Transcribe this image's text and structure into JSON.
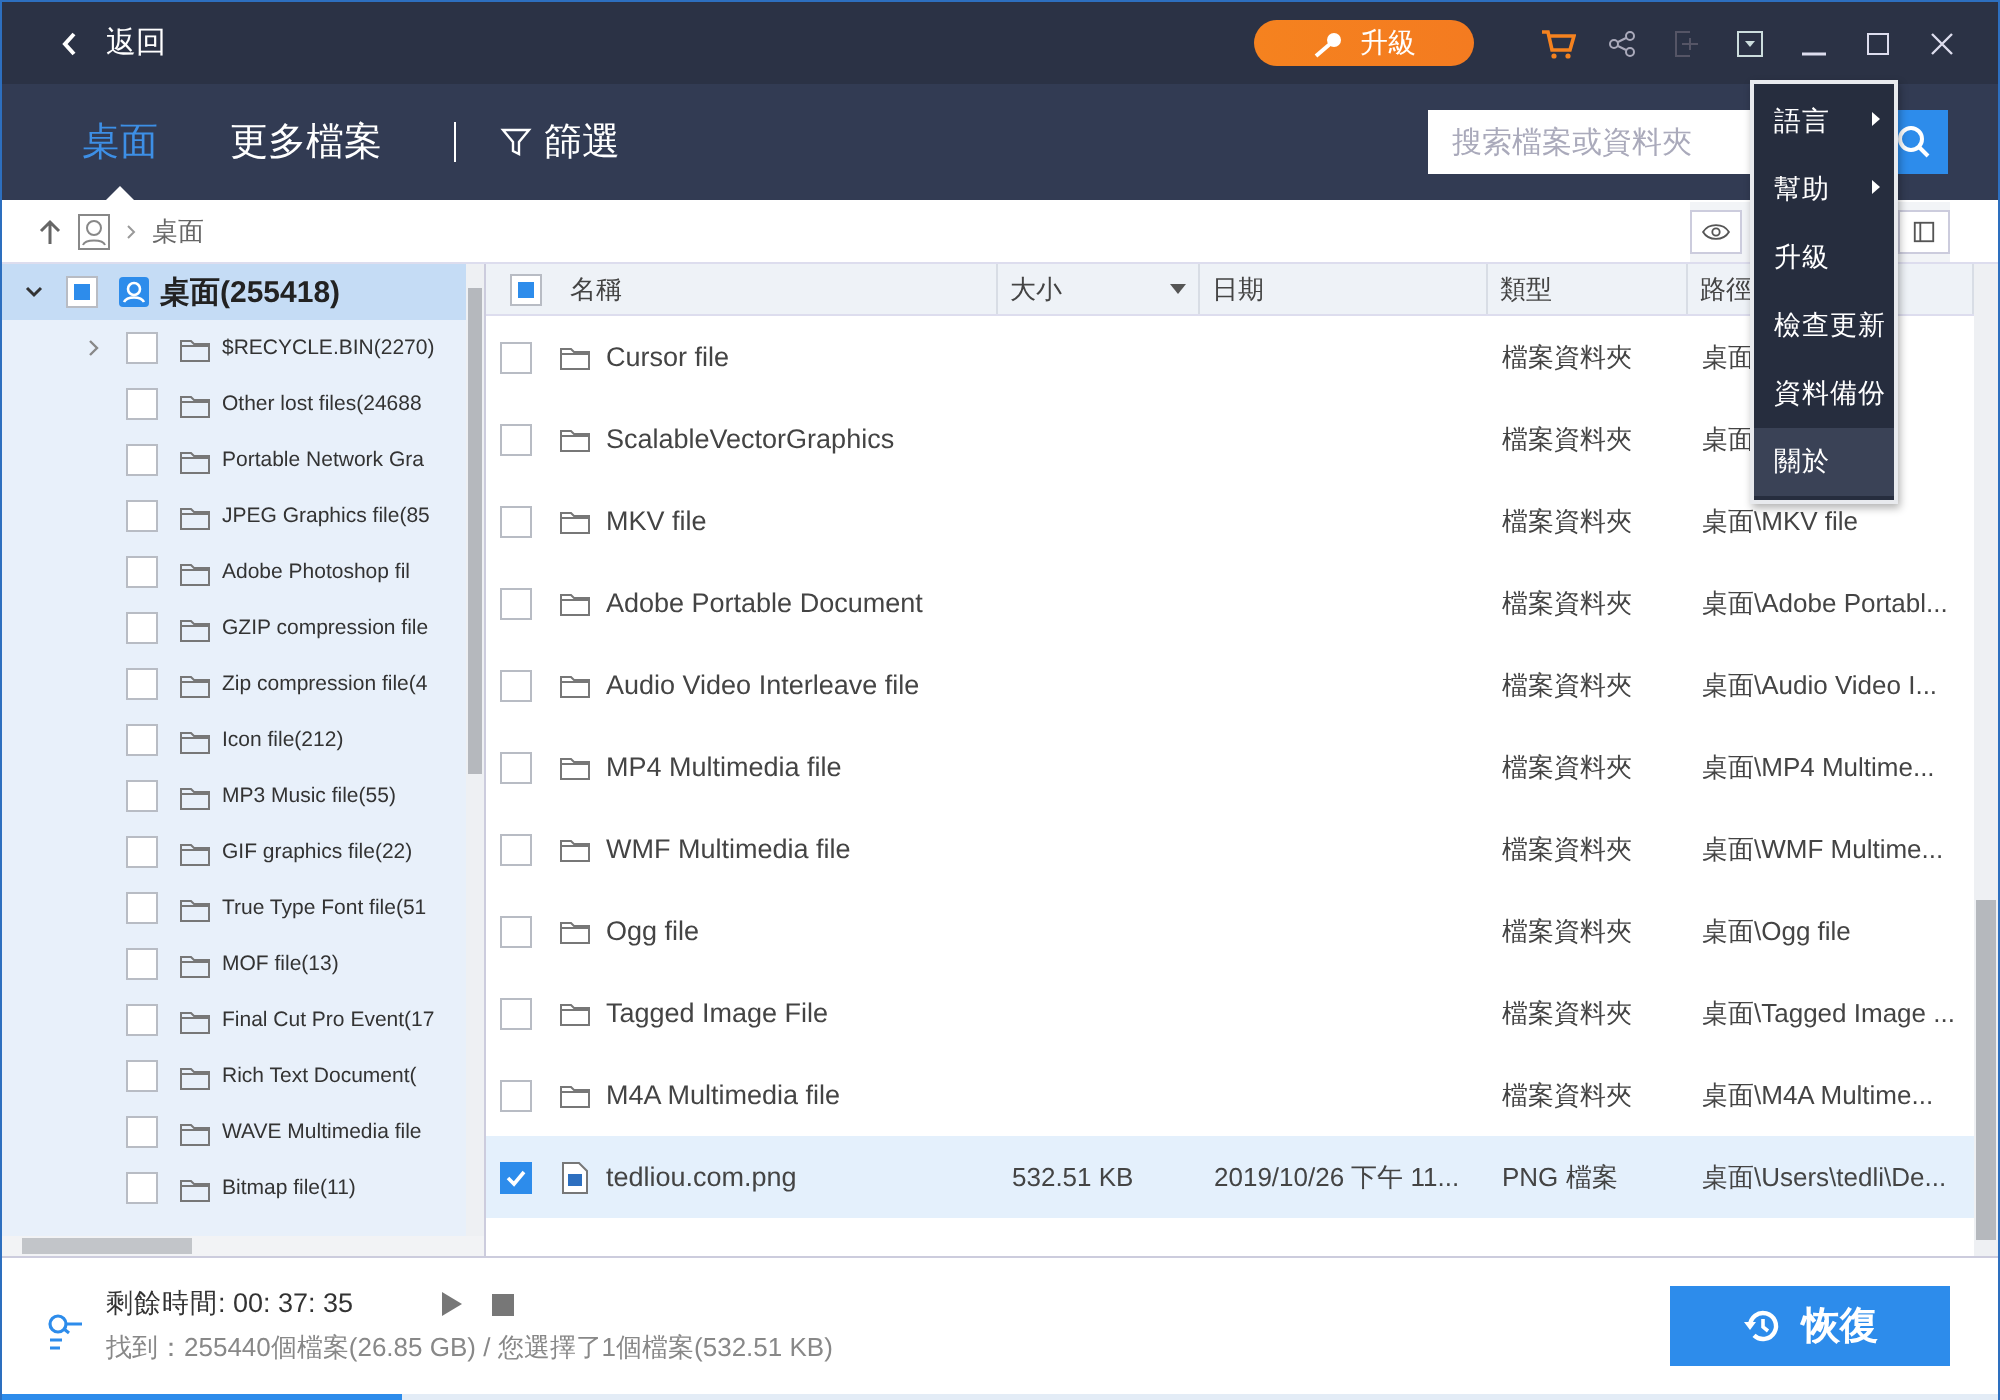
{
  "window": {
    "back": "返回",
    "upgrade": "升級"
  },
  "tabs": [
    {
      "label": "桌面",
      "selected": true
    },
    {
      "label": "更多檔案",
      "selected": false
    }
  ],
  "filter": "篩選",
  "search": {
    "placeholder": "搜索檔案或資料夾"
  },
  "menu": [
    {
      "label": "語言",
      "submenu": true,
      "selected": false
    },
    {
      "label": "幫助",
      "submenu": true,
      "selected": false
    },
    {
      "label": "升級",
      "submenu": false,
      "selected": false
    },
    {
      "label": "檢查更新",
      "submenu": false,
      "selected": false
    },
    {
      "label": "資料備份",
      "submenu": false,
      "selected": false
    },
    {
      "label": "關於",
      "submenu": false,
      "selected": true
    }
  ],
  "breadcrumb": "桌面",
  "tree": [
    {
      "label": "桌面(255418)",
      "expanded": true,
      "checked": false,
      "partial": true,
      "selected": true,
      "children": [
        {
          "label": "$RECYCLE.BIN(2270)",
          "expanded": false,
          "checked": false,
          "partial": false,
          "selected": false
        },
        {
          "label": "Other lost files(24688",
          "checked": false,
          "partial": false,
          "selected": false
        },
        {
          "label": "Portable Network Gra",
          "checked": false,
          "partial": false,
          "selected": false
        },
        {
          "label": "JPEG Graphics file(85",
          "checked": false,
          "partial": false,
          "selected": false
        },
        {
          "label": "Adobe Photoshop fil",
          "checked": false,
          "partial": false,
          "selected": false
        },
        {
          "label": "GZIP compression file",
          "checked": false,
          "partial": false,
          "selected": false
        },
        {
          "label": "Zip compression file(4",
          "checked": false,
          "partial": false,
          "selected": false
        },
        {
          "label": "Icon file(212)",
          "checked": false,
          "partial": false,
          "selected": false
        },
        {
          "label": "MP3 Music file(55)",
          "checked": false,
          "partial": false,
          "selected": false
        },
        {
          "label": "GIF graphics file(22)",
          "checked": false,
          "partial": false,
          "selected": false
        },
        {
          "label": "True Type Font file(51",
          "checked": false,
          "partial": false,
          "selected": false
        },
        {
          "label": "MOF file(13)",
          "checked": false,
          "partial": false,
          "selected": false
        },
        {
          "label": "Final Cut Pro Event(17",
          "checked": false,
          "partial": false,
          "selected": false
        },
        {
          "label": "Rich Text Document(",
          "checked": false,
          "partial": false,
          "selected": false
        },
        {
          "label": "WAVE Multimedia file",
          "checked": false,
          "partial": false,
          "selected": false
        },
        {
          "label": "Bitmap file(11)",
          "checked": false,
          "partial": false,
          "selected": false
        }
      ]
    }
  ],
  "table": {
    "header_checked": false,
    "header_partial": true,
    "columns": [
      {
        "label": "名稱",
        "sorted": false
      },
      {
        "label": "大小",
        "sorted": true
      },
      {
        "label": "日期",
        "sorted": false
      },
      {
        "label": "類型",
        "sorted": false
      },
      {
        "label": "路徑",
        "sorted": false
      }
    ],
    "rows": [
      {
        "kind": "folder",
        "name": "Cursor file",
        "type": "檔案資料夾",
        "path": "桌面",
        "checked": false,
        "selected": false
      },
      {
        "kind": "folder",
        "name": "ScalableVectorGraphics",
        "type": "檔案資料夾",
        "path": "桌面",
        "checked": false,
        "selected": false
      },
      {
        "kind": "folder",
        "name": "MKV file",
        "type": "檔案資料夾",
        "path": "桌面\\MKV file",
        "checked": false,
        "selected": false
      },
      {
        "kind": "folder",
        "name": "Adobe Portable Document",
        "type": "檔案資料夾",
        "path": "桌面\\Adobe Portabl...",
        "checked": false,
        "selected": false
      },
      {
        "kind": "folder",
        "name": "Audio Video Interleave file",
        "type": "檔案資料夾",
        "path": "桌面\\Audio Video I...",
        "checked": false,
        "selected": false
      },
      {
        "kind": "folder",
        "name": "MP4 Multimedia file",
        "type": "檔案資料夾",
        "path": "桌面\\MP4 Multime...",
        "checked": false,
        "selected": false
      },
      {
        "kind": "folder",
        "name": "WMF Multimedia file",
        "type": "檔案資料夾",
        "path": "桌面\\WMF Multime...",
        "checked": false,
        "selected": false
      },
      {
        "kind": "folder",
        "name": "Ogg file",
        "type": "檔案資料夾",
        "path": "桌面\\Ogg file",
        "checked": false,
        "selected": false
      },
      {
        "kind": "folder",
        "name": "Tagged Image File",
        "type": "檔案資料夾",
        "path": "桌面\\Tagged Image ...",
        "checked": false,
        "selected": false
      },
      {
        "kind": "folder",
        "name": "M4A Multimedia file",
        "type": "檔案資料夾",
        "path": "桌面\\M4A Multime...",
        "checked": false,
        "selected": false
      },
      {
        "kind": "image",
        "name": "tedliou.com.png",
        "size": "532.51 KB",
        "date": "2019/10/26 下午 11...",
        "type": "PNG 檔案",
        "path": "桌面\\Users\\tedli\\De...",
        "checked": true,
        "selected": true
      }
    ]
  },
  "footer": {
    "remaining": "剩餘時間: 00: 37: 35",
    "found": "找到：255440個檔案(26.85 GB) / 您選擇了1個檔案(532.51 KB)",
    "recover": "恢復",
    "level": 0.2
  }
}
